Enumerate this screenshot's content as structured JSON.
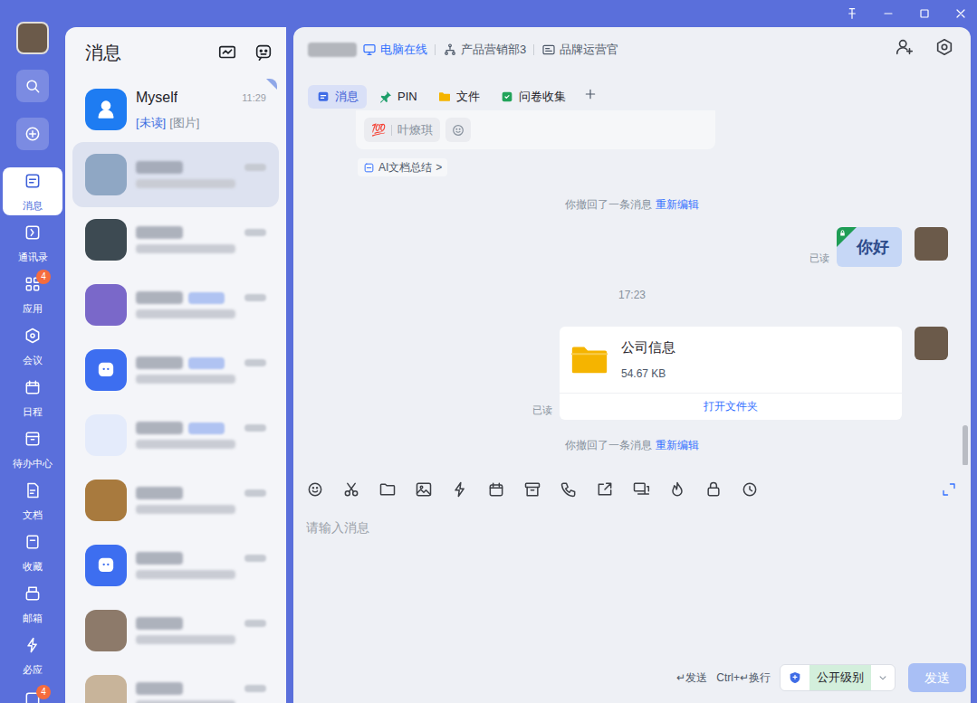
{
  "rail": {
    "items": [
      {
        "label": "消息",
        "selected": true,
        "badge": ""
      },
      {
        "label": "通讯录",
        "selected": false,
        "badge": ""
      },
      {
        "label": "应用",
        "selected": false,
        "badge": "4"
      },
      {
        "label": "会议",
        "selected": false,
        "badge": ""
      },
      {
        "label": "日程",
        "selected": false,
        "badge": ""
      },
      {
        "label": "待办中心",
        "selected": false,
        "badge": ""
      },
      {
        "label": "文档",
        "selected": false,
        "badge": ""
      },
      {
        "label": "收藏",
        "selected": false,
        "badge": ""
      },
      {
        "label": "邮箱",
        "selected": false,
        "badge": ""
      },
      {
        "label": "必应",
        "selected": false,
        "badge": ""
      }
    ],
    "overflow_badge": "4"
  },
  "list": {
    "title": "消息",
    "items": [
      {
        "kind": "contact",
        "name": "Myself",
        "time": "11:29",
        "unread_tag": "[未读]",
        "preview": "[图片]",
        "selected": false,
        "pinned": true,
        "tagged": false,
        "color": "#1e7cf2"
      },
      {
        "kind": "blurred",
        "selected": true,
        "pinned": false,
        "tagged": false,
        "color": "#8fa7c4"
      },
      {
        "kind": "blurred",
        "selected": false,
        "pinned": false,
        "tagged": false,
        "color": "#3d4a52"
      },
      {
        "kind": "blurred",
        "selected": false,
        "pinned": false,
        "tagged": true,
        "color": "#7a68c9"
      },
      {
        "kind": "blurred",
        "selected": false,
        "pinned": false,
        "tagged": true,
        "color": "#3d6ef0"
      },
      {
        "kind": "blurred",
        "selected": false,
        "pinned": false,
        "tagged": true,
        "color": "#e4ebfb"
      },
      {
        "kind": "blurred",
        "selected": false,
        "pinned": false,
        "tagged": false,
        "color": "#a87a3e"
      },
      {
        "kind": "blurred",
        "selected": false,
        "pinned": false,
        "tagged": false,
        "color": "#3d6ef0"
      },
      {
        "kind": "blurred",
        "selected": false,
        "pinned": false,
        "tagged": false,
        "color": "#8d7a6a"
      },
      {
        "kind": "blurred",
        "selected": false,
        "pinned": false,
        "tagged": false,
        "color": "#c8b49a"
      }
    ]
  },
  "chat": {
    "status": "电脑在线",
    "department": "产品营销部3",
    "role": "品牌运营官",
    "tabs": [
      {
        "label": "消息",
        "selected": true
      },
      {
        "label": "PIN",
        "selected": false
      },
      {
        "label": "文件",
        "selected": false
      },
      {
        "label": "问卷收集",
        "selected": false
      }
    ],
    "messages": [
      {
        "kind": "card",
        "reaction": "💯",
        "reactor": "叶燎琪",
        "summary": "AI文档总结",
        "chevron": ">"
      },
      {
        "kind": "notice",
        "text": "你撤回了一条消息",
        "action": "重新编辑"
      },
      {
        "kind": "text",
        "text": "你好",
        "receipt": "已读",
        "locked": true
      },
      {
        "kind": "time",
        "text": "17:23"
      },
      {
        "kind": "file",
        "name": "公司信息",
        "size": "54.67 KB",
        "action": "打开文件夹",
        "receipt": "已读"
      },
      {
        "kind": "notice",
        "text": "你撤回了一条消息",
        "action": "重新编辑"
      }
    ],
    "input": {
      "placeholder": "请输入消息"
    },
    "footer": {
      "send_hint": "↵发送",
      "newline_hint": "Ctrl+↵换行",
      "security_level": "公开级别",
      "send": "发送",
      "send_disabled": true
    }
  }
}
